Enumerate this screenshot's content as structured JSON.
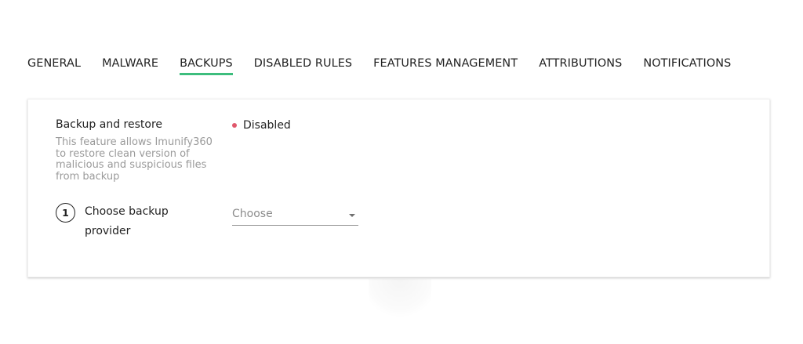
{
  "tabs": [
    {
      "label": "GENERAL",
      "active": false
    },
    {
      "label": "MALWARE",
      "active": false
    },
    {
      "label": "BACKUPS",
      "active": true
    },
    {
      "label": "DISABLED RULES",
      "active": false
    },
    {
      "label": "FEATURES MANAGEMENT",
      "active": false
    },
    {
      "label": "ATTRIBUTIONS",
      "active": false
    },
    {
      "label": "NOTIFICATIONS",
      "active": false
    }
  ],
  "backup": {
    "title": "Backup and restore",
    "description": "This feature allows Imunify360 to restore clean version of malicious and suspicious files from backup",
    "status": "Disabled"
  },
  "provider": {
    "step_number": "1",
    "label": "Choose backup provider",
    "select_value": "Choose"
  },
  "colors": {
    "accent": "#3dbd7d",
    "status_disabled": "#e0586c",
    "muted_text": "#9a9a9a"
  }
}
